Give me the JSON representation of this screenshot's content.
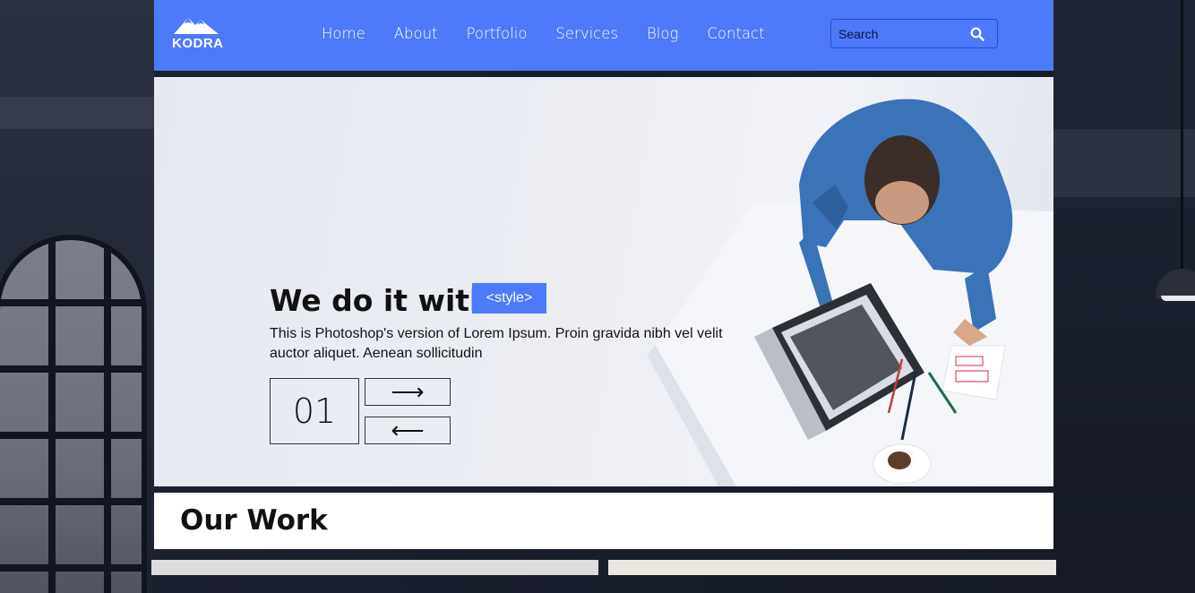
{
  "brand": {
    "name": "KODRA"
  },
  "nav": {
    "items": [
      {
        "label": "Home"
      },
      {
        "label": "About"
      },
      {
        "label": "Portfolio"
      },
      {
        "label": "Services"
      },
      {
        "label": "Blog"
      },
      {
        "label": "Contact"
      }
    ]
  },
  "search": {
    "placeholder": "Search",
    "icon": "search-icon"
  },
  "hero": {
    "title": "We do it with",
    "badge": "<style>",
    "text": "This is Photoshop's version of Lorem Ipsum. Proin gravida nibh vel velit auctor aliquet. Aenean sollicitudin",
    "slide_number": "01",
    "next_arrow": "⟶",
    "prev_arrow": "⟵",
    "image": "person-working-on-laptop-top-view"
  },
  "work": {
    "title": "Our Work"
  },
  "colors": {
    "accent": "#4d79fb",
    "text": "#111111",
    "hero_bg": "#eceef4"
  }
}
